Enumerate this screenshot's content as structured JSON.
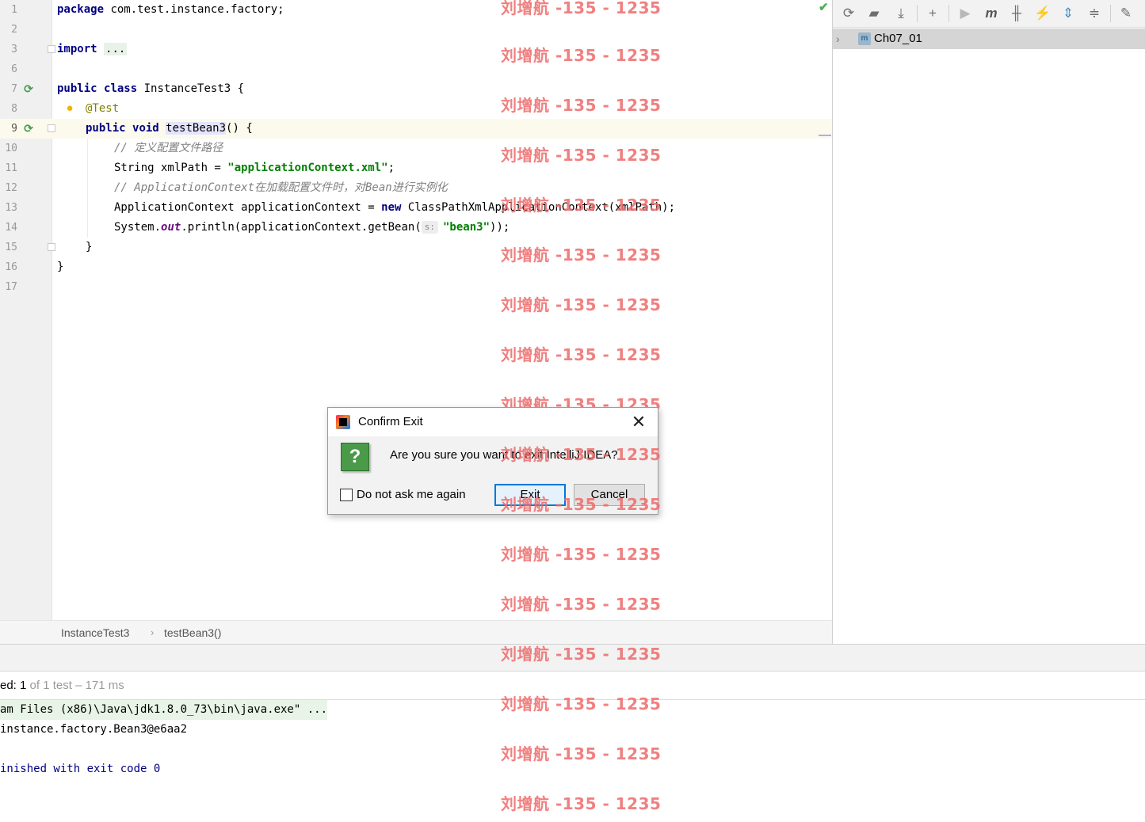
{
  "editor": {
    "lines": [
      {
        "n": "1"
      },
      {
        "n": "2"
      },
      {
        "n": "3"
      },
      {
        "n": "6"
      },
      {
        "n": "7"
      },
      {
        "n": "8"
      },
      {
        "n": "9"
      },
      {
        "n": "10"
      },
      {
        "n": "11"
      },
      {
        "n": "12"
      },
      {
        "n": "13"
      },
      {
        "n": "14"
      },
      {
        "n": "15"
      },
      {
        "n": "16"
      },
      {
        "n": "17"
      }
    ],
    "code": {
      "kw_package": "package",
      "pkg_name": " com.test.instance.factory;",
      "kw_import": "import",
      "import_ellipsis": "...",
      "kw_public": "public",
      "kw_class": "class",
      "class_decl": " InstanceTest3 {",
      "annotation": "@Test",
      "kw_void": "void",
      "method_name": "testBean3",
      "method_rest": "() {",
      "comment1": "// 定义配置文件路径",
      "string_type": "String xmlPath = ",
      "xml_path_literal": "\"applicationContext.xml\"",
      "semicolon": ";",
      "comment2": "// ApplicationContext在加载配置文件时，对Bean进行实例化",
      "ctx_decl": "ApplicationContext applicationContext = ",
      "kw_new": "new",
      "ctx_ctor": " ClassPathXmlApplicationContext(xmlPath);",
      "sysout_prefix": "System.",
      "sysout_field": "out",
      "sysout_rest": ".println(applicationContext.getBean(",
      "param_hint": "s:",
      "bean_literal": "\"bean3\"",
      "sysout_end": "));",
      "close_method": "}",
      "close_class": "}"
    }
  },
  "breadcrumb": {
    "class_name": "InstanceTest3",
    "separator": "›",
    "method_name": "testBean3()"
  },
  "right_panel": {
    "toolbar_icons": [
      "refresh-icon",
      "folder-generate-icon",
      "download-icon",
      "add-icon",
      "run-icon",
      "maven-m-icon",
      "toggle-offline-icon",
      "lightning-icon",
      "expand-all-icon",
      "collapse-all-icon",
      "wrench-icon"
    ],
    "tree": {
      "arrow": "›",
      "project_name": "Ch07_01"
    }
  },
  "run_panel": {
    "status_prefix": "ed: ",
    "status_count": "1",
    "status_rest": " of 1 test – 171 ms",
    "console": {
      "cmd_line": "am Files (x86)\\Java\\jdk1.8.0_73\\bin\\java.exe\" ...",
      "output_line": "instance.factory.Bean3@e6aa2",
      "exit_line": "inished with exit code 0"
    }
  },
  "watermark": {
    "text": "刘增航 -135 - 1235"
  },
  "dialog": {
    "title": "Confirm Exit",
    "close_glyph": "✕",
    "question_glyph": "?",
    "message": "Are you sure you want to exit IntelliJ IDEA?",
    "checkbox_label": "Do not ask me again",
    "checkbox_checked": false,
    "exit_button": "Exit",
    "cancel_button": "Cancel"
  }
}
